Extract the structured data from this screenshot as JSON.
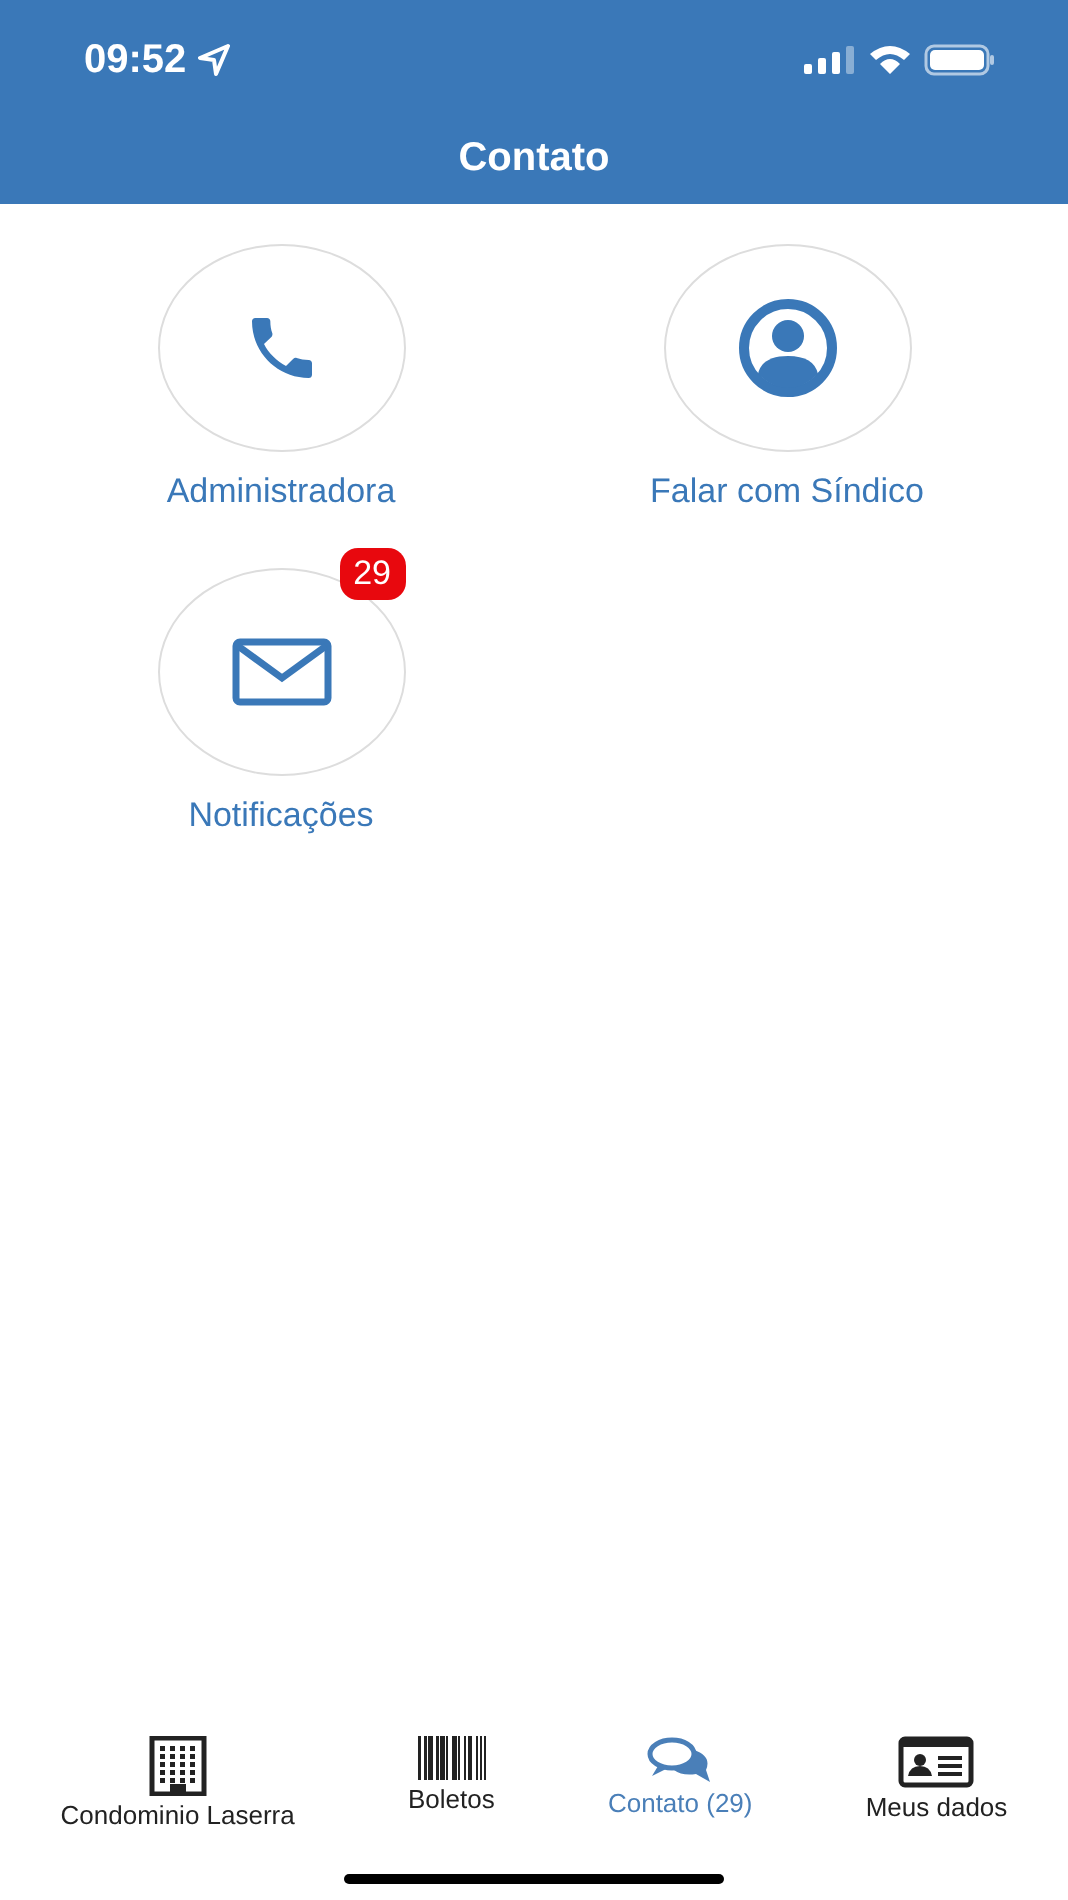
{
  "status_bar": {
    "time": "09:52"
  },
  "header": {
    "title": "Contato"
  },
  "actions": [
    {
      "label": "Administradora",
      "kind": "phone"
    },
    {
      "label": "Falar com Síndico",
      "kind": "person"
    },
    {
      "label": "Notificações",
      "kind": "mail",
      "badge": "29"
    }
  ],
  "tabs": [
    {
      "label": "Condominio Laserra",
      "kind": "building",
      "selected": false
    },
    {
      "label": "Boletos",
      "kind": "barcode",
      "selected": false
    },
    {
      "label": "Contato (29)",
      "kind": "chat",
      "selected": true
    },
    {
      "label": "Meus dados",
      "kind": "idcard",
      "selected": false
    }
  ]
}
